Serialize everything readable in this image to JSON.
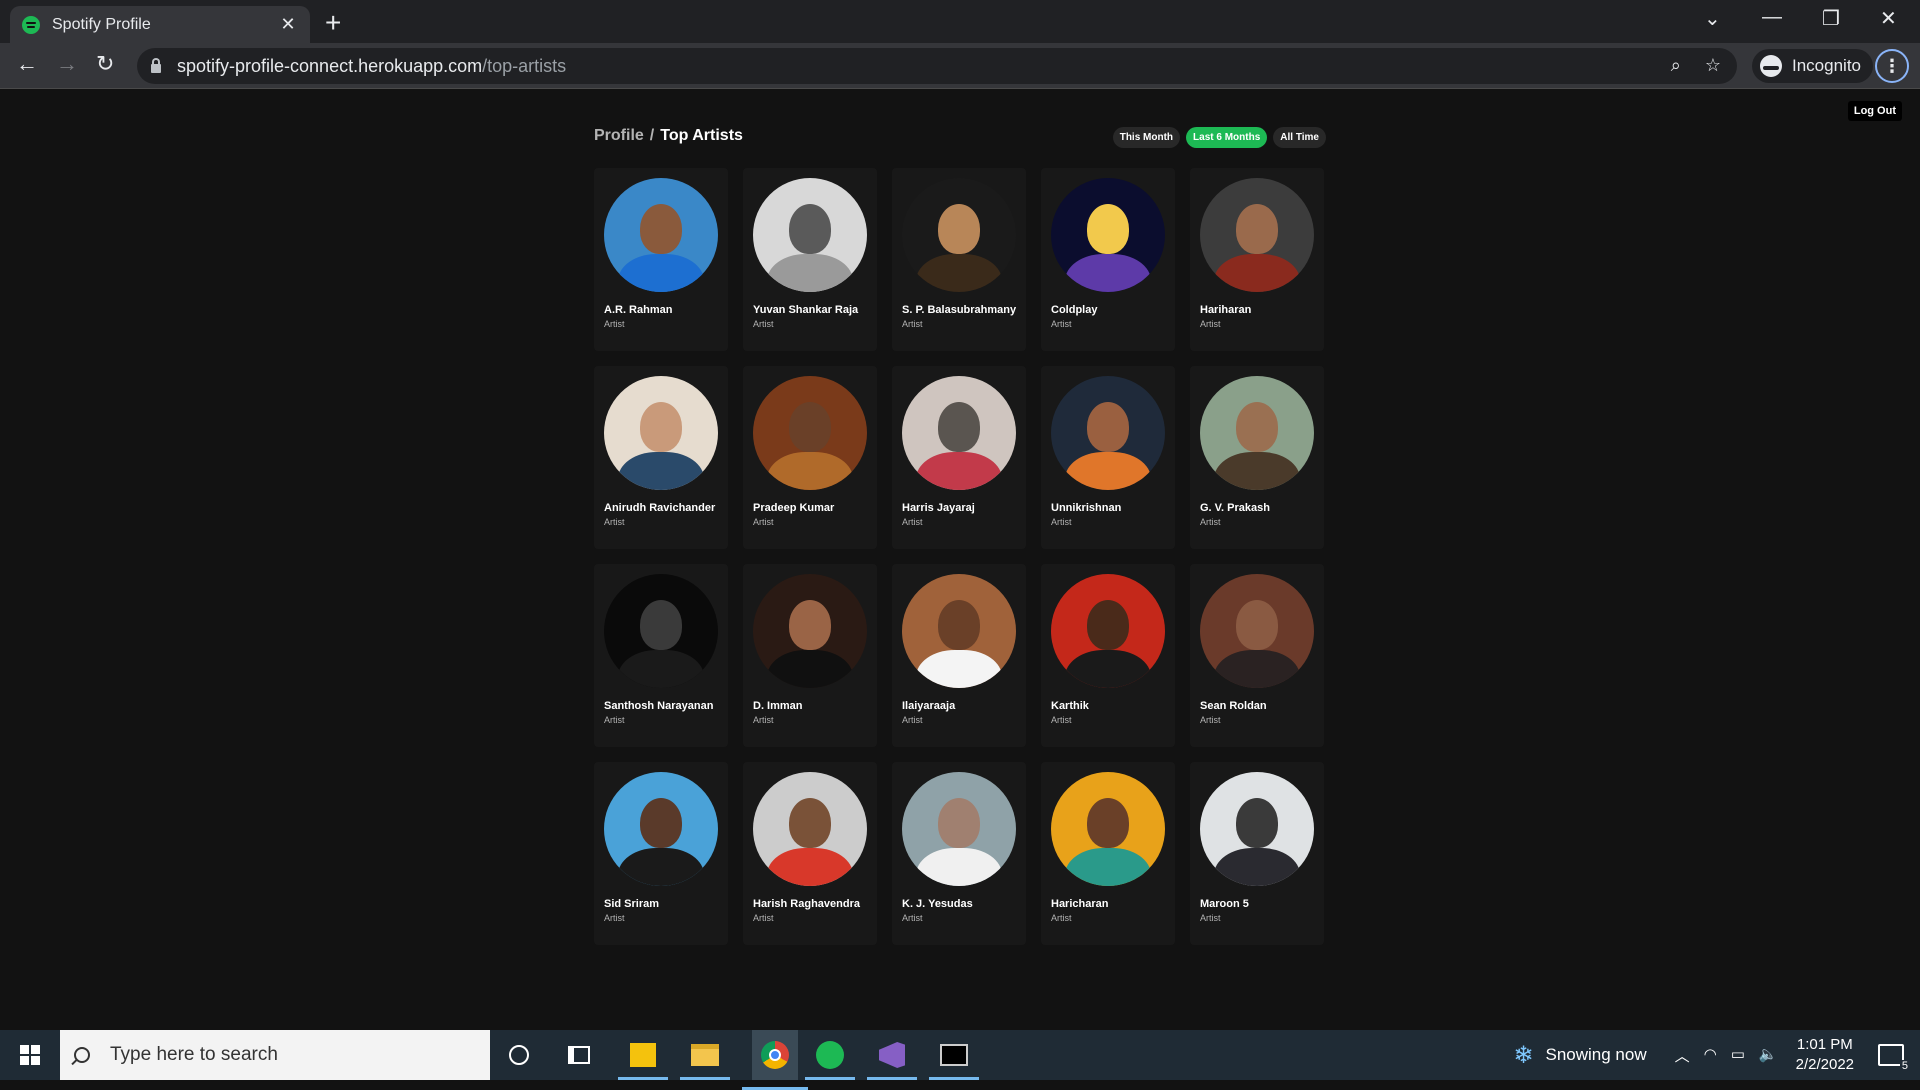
{
  "browser": {
    "tab_title": "Spotify Profile",
    "tab_close": "✕",
    "new_tab": "+",
    "url_host": "spotify-profile-connect.herokuapp.com",
    "url_path": "/top-artists",
    "profile_label": "Incognito"
  },
  "page": {
    "logout_label": "Log Out",
    "breadcrumb_root": "Profile",
    "breadcrumb_sep": "/",
    "breadcrumb_current": "Top Artists",
    "filters": [
      {
        "label": "This Month",
        "active": false
      },
      {
        "label": "Last 6 Months",
        "active": true
      },
      {
        "label": "All Time",
        "active": false
      }
    ],
    "artists": [
      {
        "name": "A.R. Rahman",
        "role": "Artist",
        "bg": "#3a88c8",
        "skin": "#8a5a3c",
        "cloth": "#1d6fd1"
      },
      {
        "name": "Yuvan Shankar Raja",
        "role": "Artist",
        "bg": "#d8d8d8",
        "skin": "#5a5a5a",
        "cloth": "#9a9a9a"
      },
      {
        "name": "S. P. Balasubrahmanyam",
        "role": "Artist",
        "bg": "#1a1a1a",
        "skin": "#b88658",
        "cloth": "#3a2a1a"
      },
      {
        "name": "Coldplay",
        "role": "Artist",
        "bg": "#0b0d2e",
        "skin": "#f2c94c",
        "cloth": "#5d3aa8"
      },
      {
        "name": "Hariharan",
        "role": "Artist",
        "bg": "#3c3c3c",
        "skin": "#9a6a4c",
        "cloth": "#8a2a1e"
      },
      {
        "name": "Anirudh Ravichander",
        "role": "Artist",
        "bg": "#e6dccf",
        "skin": "#c99a7a",
        "cloth": "#2a4a6a"
      },
      {
        "name": "Pradeep Kumar",
        "role": "Artist",
        "bg": "#7a3a1a",
        "skin": "#6a4028",
        "cloth": "#b06a2a"
      },
      {
        "name": "Harris Jayaraj",
        "role": "Artist",
        "bg": "#cfc5bf",
        "skin": "#5a5550",
        "cloth": "#c23a4a"
      },
      {
        "name": "Unnikrishnan",
        "role": "Artist",
        "bg": "#1f2a3a",
        "skin": "#9a6040",
        "cloth": "#e0762a"
      },
      {
        "name": "G. V. Prakash",
        "role": "Artist",
        "bg": "#8aa08a",
        "skin": "#9a7052",
        "cloth": "#4a3a2a"
      },
      {
        "name": "Santhosh Narayanan",
        "role": "Artist",
        "bg": "#0a0a0a",
        "skin": "#3a3a3a",
        "cloth": "#1a1a1a"
      },
      {
        "name": "D. Imman",
        "role": "Artist",
        "bg": "#2a1a14",
        "skin": "#9a6446",
        "cloth": "#101010"
      },
      {
        "name": "Ilaiyaraaja",
        "role": "Artist",
        "bg": "#a0623a",
        "skin": "#6a4028",
        "cloth": "#f4f4f4"
      },
      {
        "name": "Karthik",
        "role": "Artist",
        "bg": "#c4281a",
        "skin": "#4a2a1a",
        "cloth": "#1a1a1a"
      },
      {
        "name": "Sean Roldan",
        "role": "Artist",
        "bg": "#6a3a2a",
        "skin": "#8a5a42",
        "cloth": "#2a2222"
      },
      {
        "name": "Sid Sriram",
        "role": "Artist",
        "bg": "#4aa2d8",
        "skin": "#5a3a2a",
        "cloth": "#1a1a1a"
      },
      {
        "name": "Harish Raghavendra",
        "role": "Artist",
        "bg": "#cccccc",
        "skin": "#7a5238",
        "cloth": "#d8382a"
      },
      {
        "name": "K. J. Yesudas",
        "role": "Artist",
        "bg": "#8fa2a8",
        "skin": "#a08070",
        "cloth": "#f0f0f0"
      },
      {
        "name": "Haricharan",
        "role": "Artist",
        "bg": "#e8a21a",
        "skin": "#6a4028",
        "cloth": "#2a9a8a"
      },
      {
        "name": "Maroon 5",
        "role": "Artist",
        "bg": "#dfe2e4",
        "skin": "#3a3a3a",
        "cloth": "#2a2a30"
      }
    ]
  },
  "taskbar": {
    "search_placeholder": "Type here to search",
    "weather": "Snowing now",
    "time": "1:01 PM",
    "date": "2/2/2022",
    "notifications": "5"
  }
}
